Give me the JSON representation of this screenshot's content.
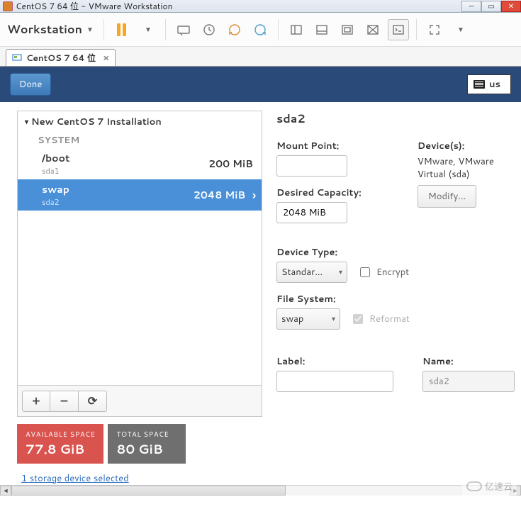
{
  "vmware": {
    "title": "CentOS 7 64 位 - VMware Workstation",
    "menu_label": "Workstation",
    "tab_label": "CentOS 7 64 位"
  },
  "installer": {
    "done_label": "Done",
    "keyboard_layout": "us",
    "tree_title": "New CentOS 7 Installation",
    "group_system": "SYSTEM",
    "partitions": [
      {
        "mount": "/boot",
        "device": "sda1",
        "size": "200 MiB",
        "selected": false
      },
      {
        "mount": "swap",
        "device": "sda2",
        "size": "2048 MiB",
        "selected": true
      }
    ],
    "footer_add": "+",
    "footer_remove": "–",
    "footer_reload": "⟳",
    "space": {
      "available_label": "AVAILABLE SPACE",
      "available_value": "77.8 GiB",
      "total_label": "TOTAL SPACE",
      "total_value": "80 GiB"
    },
    "storage_link": "1 storage device selected"
  },
  "detail": {
    "title": "sda2",
    "mount_point_label": "Mount Point:",
    "mount_point_value": "",
    "desired_capacity_label": "Desired Capacity:",
    "desired_capacity_value": "2048 MiB",
    "devices_label": "Device(s):",
    "devices_value": "VMware, VMware Virtual (sda)",
    "modify_label": "Modify...",
    "device_type_label": "Device Type:",
    "device_type_value": "Standar...",
    "encrypt_label": "Encrypt",
    "file_system_label": "File System:",
    "file_system_value": "swap",
    "reformat_label": "Reformat",
    "label_label": "Label:",
    "label_value": "",
    "name_label": "Name:",
    "name_value": "sda2"
  },
  "watermark": "亿速云"
}
